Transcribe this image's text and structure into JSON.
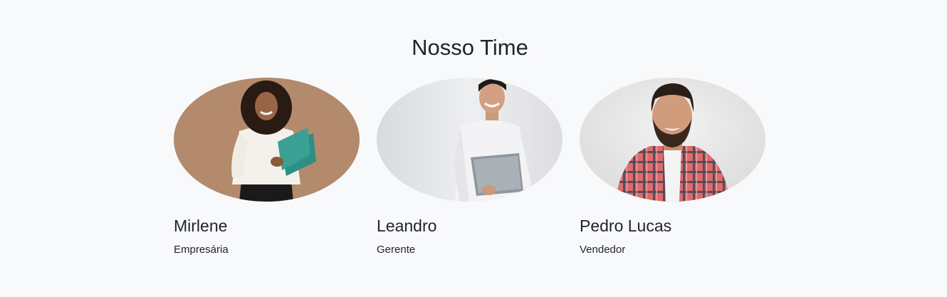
{
  "team": {
    "title": "Nosso Time",
    "members": [
      {
        "name": "Mirlene",
        "role": "Empresária",
        "photo_icon": "woman-portrait"
      },
      {
        "name": "Leandro",
        "role": "Gerente",
        "photo_icon": "man-laptop-portrait"
      },
      {
        "name": "Pedro Lucas",
        "role": "Vendedor",
        "photo_icon": "bearded-man-portrait"
      }
    ]
  },
  "colors": {
    "background": "#f8f9fb",
    "text": "#212529",
    "photo1_backdrop": "#b48a6c",
    "photo2_backdrop": "#e4e5e8",
    "photo3_backdrop": "#e6e6e6"
  }
}
